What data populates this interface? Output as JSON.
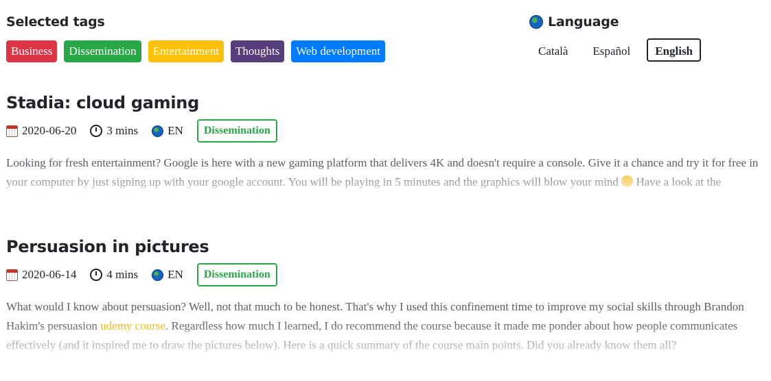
{
  "tags_section": {
    "title": "Selected tags",
    "tags": [
      {
        "label": "Business",
        "color": "#dc3545"
      },
      {
        "label": "Dissemination",
        "color": "#28a745"
      },
      {
        "label": "Entertainment",
        "color": "#ffc107"
      },
      {
        "label": "Thoughts",
        "color": "#563d7c"
      },
      {
        "label": "Web development",
        "color": "#007bff"
      }
    ]
  },
  "language_section": {
    "title": "Language",
    "icon": "globe-icon",
    "options": [
      {
        "label": "Català",
        "active": false
      },
      {
        "label": "Español",
        "active": false
      },
      {
        "label": "English",
        "active": true
      }
    ]
  },
  "posts": [
    {
      "title": "Stadia: cloud gaming",
      "date": "2020-06-20",
      "read_time": "3 mins",
      "language": "EN",
      "tag": "Dissemination",
      "excerpt_a": "Looking for fresh entertainment? Google is here with a new gaming platform that delivers 4K and doesn't require a console. Give it a chance and try it for free in your computer by just signing up with your google account. You will be playing in 5 minutes and the graphics will blow your mind ",
      "excerpt_b": " Have a look at the screenshots at the end of the post if you still have any doubt!"
    },
    {
      "title": "Persuasion in pictures",
      "date": "2020-06-14",
      "read_time": "4 mins",
      "language": "EN",
      "tag": "Dissemination",
      "excerpt_a": "What would I know about persuasion? Well, not that much to be honest. That's why I used this confinement time to improve my social skills through Brandon Hakim's persuasion ",
      "link": "udemy course",
      "excerpt_b": ". Regardless how much I learned, I do recommend the course because it made me ponder about how people communicates effectively (and it inspired me to draw the pictures below). Here is a quick summary of the course main points. Did you already know them all?"
    }
  ]
}
